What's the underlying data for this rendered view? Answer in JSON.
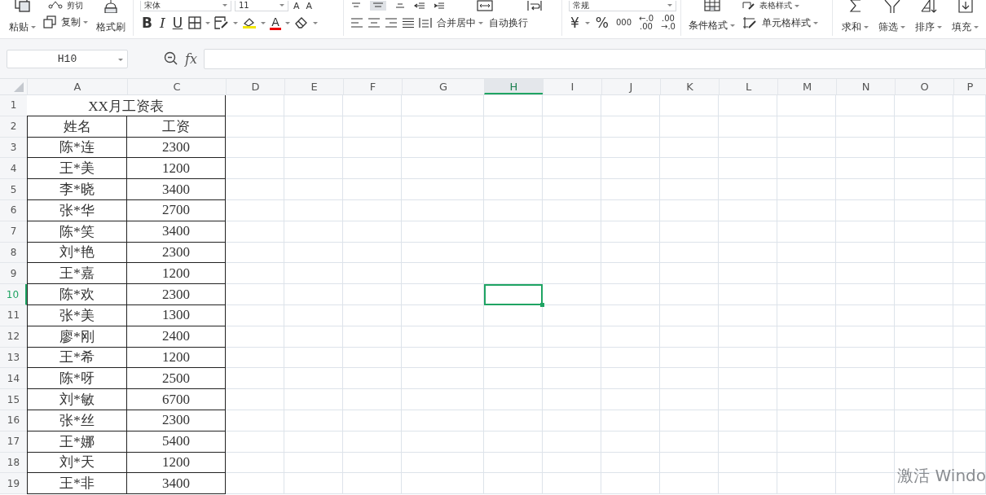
{
  "ribbon": {
    "clipboard": {
      "cut": "剪切",
      "paste": "粘贴",
      "copy": "复制",
      "painter": "格式刷"
    },
    "font": {
      "name": "宋体",
      "size": "11",
      "grow": "A",
      "shrink": "A",
      "bold": "B",
      "italic": "I",
      "underline": "U",
      "text_color": "A"
    },
    "alignment": {
      "merge": "合并居中",
      "wrap": "自动换行"
    },
    "number": {
      "format": "常规",
      "currency": "¥",
      "percent": "%",
      "thousands": "000",
      "inc_top": "←.0",
      "inc_bottom": ".00",
      "dec_top": ".00",
      "dec_bottom": "→.0"
    },
    "styles": {
      "table": "表格样式",
      "conditional": "条件格式",
      "cell": "单元格样式"
    },
    "editing": [
      {
        "label": "求和"
      },
      {
        "label": "筛选"
      },
      {
        "label": "排序"
      },
      {
        "label": "填充"
      }
    ]
  },
  "name_box": "H10",
  "formula_label": "fx",
  "columns": [
    {
      "label": "A",
      "selected": false
    },
    {
      "label": "C",
      "selected": false
    },
    {
      "label": "D",
      "selected": false
    },
    {
      "label": "E",
      "selected": false
    },
    {
      "label": "F",
      "selected": false
    },
    {
      "label": "G",
      "selected": false
    },
    {
      "label": "H",
      "selected": true
    },
    {
      "label": "I",
      "selected": false
    },
    {
      "label": "J",
      "selected": false
    },
    {
      "label": "K",
      "selected": false
    },
    {
      "label": "L",
      "selected": false
    },
    {
      "label": "M",
      "selected": false
    },
    {
      "label": "N",
      "selected": false
    },
    {
      "label": "O",
      "selected": false
    },
    {
      "label": "P",
      "selected": false
    }
  ],
  "rows": [
    {
      "number": "1",
      "selected": false
    },
    {
      "number": "2",
      "selected": false
    },
    {
      "number": "3",
      "selected": false
    },
    {
      "number": "4",
      "selected": false
    },
    {
      "number": "5",
      "selected": false
    },
    {
      "number": "6",
      "selected": false
    },
    {
      "number": "7",
      "selected": false
    },
    {
      "number": "8",
      "selected": false
    },
    {
      "number": "9",
      "selected": false
    },
    {
      "number": "10",
      "selected": true
    },
    {
      "number": "11",
      "selected": false
    },
    {
      "number": "12",
      "selected": false
    },
    {
      "number": "13",
      "selected": false
    },
    {
      "number": "14",
      "selected": false
    },
    {
      "number": "15",
      "selected": false
    },
    {
      "number": "16",
      "selected": false
    },
    {
      "number": "17",
      "selected": false
    },
    {
      "number": "18",
      "selected": false
    },
    {
      "number": "19",
      "selected": false
    }
  ],
  "table": {
    "title": "XX月工资表",
    "headers": [
      "姓名",
      "工资"
    ],
    "records": [
      {
        "name": "陈*连",
        "salary": "2300"
      },
      {
        "name": "王*美",
        "salary": "1200"
      },
      {
        "name": "李*晓",
        "salary": "3400"
      },
      {
        "name": "张*华",
        "salary": "2700"
      },
      {
        "name": "陈*笑",
        "salary": "3400"
      },
      {
        "name": "刘*艳",
        "salary": "2300"
      },
      {
        "name": "王*嘉",
        "salary": "1200"
      },
      {
        "name": "陈*欢",
        "salary": "2300"
      },
      {
        "name": "张*美",
        "salary": "1300"
      },
      {
        "name": "廖*刚",
        "salary": "2400"
      },
      {
        "name": "王*希",
        "salary": "1200"
      },
      {
        "name": "陈*呀",
        "salary": "2500"
      },
      {
        "name": "刘*敏",
        "salary": "6700"
      },
      {
        "name": "张*丝",
        "salary": "2300"
      },
      {
        "name": "王*娜",
        "salary": "5400"
      },
      {
        "name": "刘*天",
        "salary": "1200"
      },
      {
        "name": "王*非",
        "salary": "3400"
      }
    ]
  },
  "activation_notice": "激活 Windo"
}
